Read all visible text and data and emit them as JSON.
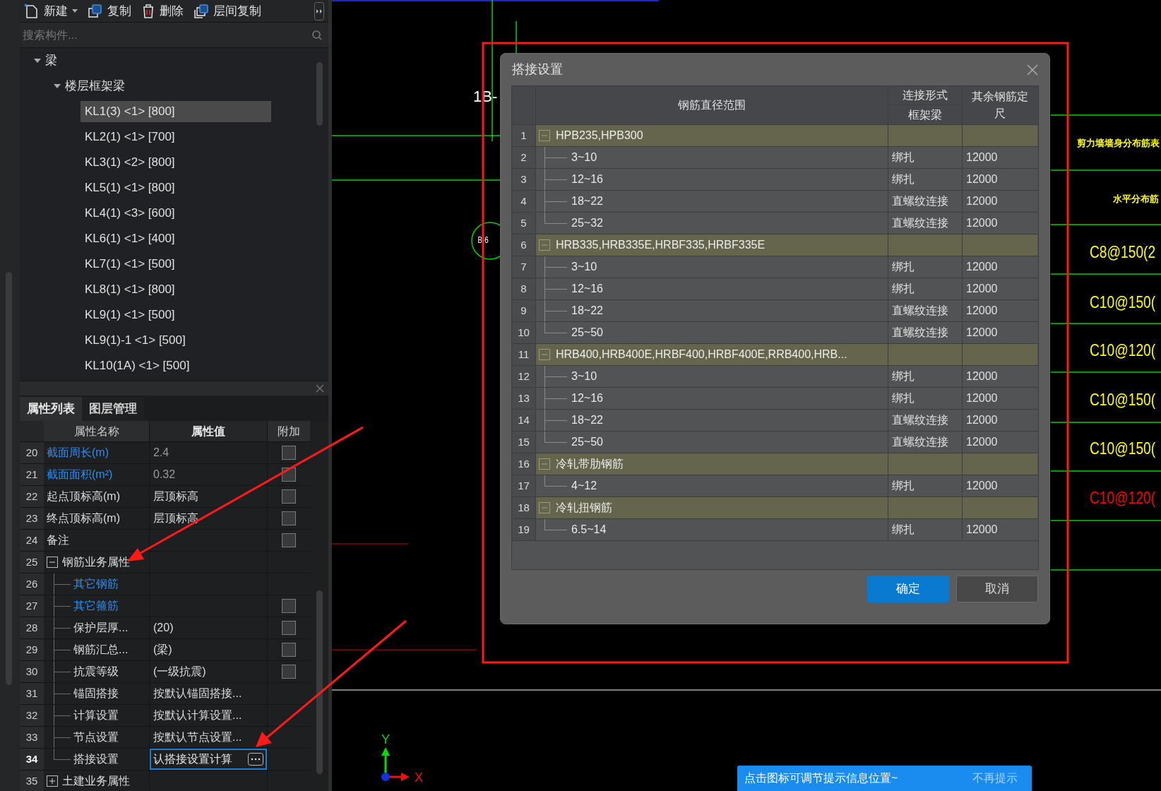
{
  "toolbar": {
    "buttons": [
      {
        "label": "新建",
        "kind": "new",
        "has_menu": true
      },
      {
        "label": "复制",
        "kind": "copy",
        "has_menu": false
      },
      {
        "label": "删除",
        "kind": "delete",
        "has_menu": false
      },
      {
        "label": "层间复制",
        "kind": "floor-copy",
        "has_menu": false
      }
    ]
  },
  "search": {
    "placeholder": "搜索构件..."
  },
  "tree": [
    {
      "label": "梁",
      "expanded": true,
      "children": [
        {
          "label": "楼层框架梁",
          "expanded": true,
          "children": [
            {
              "label": "KL1(3) <1> [800]",
              "selected": true
            },
            {
              "label": "KL2(1) <1> [700]",
              "selected": false
            },
            {
              "label": "KL3(1) <2> [800]",
              "selected": false
            },
            {
              "label": "KL5(1) <1> [800]",
              "selected": false
            },
            {
              "label": "KL4(1) <3> [600]",
              "selected": false
            },
            {
              "label": "KL6(1) <1> [400]",
              "selected": false
            },
            {
              "label": "KL7(1) <1> [500]",
              "selected": false
            },
            {
              "label": "KL8(1) <1> [800]",
              "selected": false
            },
            {
              "label": "KL9(1) <1> [500]",
              "selected": false
            },
            {
              "label": "KL9(1)-1 <1> [500]",
              "selected": false
            },
            {
              "label": "KL10(1A) <1> [500]",
              "selected": false
            }
          ]
        }
      ]
    }
  ],
  "properties": {
    "tabs": [
      {
        "label": "属性列表",
        "selected": true
      },
      {
        "label": "图层管理",
        "selected": false
      }
    ],
    "columns": [
      "属性名称",
      "属性值",
      "附加"
    ],
    "rows": [
      {
        "num": "20",
        "name": "截面周长(m)",
        "value": "2.4",
        "highlighted": true,
        "checked": false,
        "selected": false
      },
      {
        "num": "21",
        "name": "截面面积(m²)",
        "value": "0.32",
        "highlighted": true,
        "checked": false,
        "selected": false
      },
      {
        "num": "22",
        "name": "起点顶标高(m)",
        "value": "层顶标高",
        "highlighted": false,
        "checked": false,
        "selected": false
      },
      {
        "num": "23",
        "name": "终点顶标高(m)",
        "value": "层顶标高",
        "highlighted": false,
        "checked": false,
        "selected": false
      },
      {
        "num": "24",
        "name": "备注",
        "highlighted": false,
        "checked": false,
        "selected": false
      },
      {
        "num": "25",
        "name": "钢筋业务属性",
        "highlighted": false,
        "selected": false,
        "expanded": true,
        "children": [
          {
            "num": "26",
            "name": "其它钢筋",
            "highlighted": true,
            "selected": false
          },
          {
            "num": "27",
            "name": "其它箍筋",
            "highlighted": true,
            "checked": false,
            "selected": false
          },
          {
            "num": "28",
            "name": "保护层厚...",
            "value": "(20)",
            "highlighted": false,
            "checked": false,
            "selected": false
          },
          {
            "num": "29",
            "name": "钢筋汇总...",
            "value": "(梁)",
            "highlighted": false,
            "checked": false,
            "selected": false
          },
          {
            "num": "30",
            "name": "抗震等级",
            "value": "(一级抗震)",
            "highlighted": false,
            "checked": false,
            "selected": false
          },
          {
            "num": "31",
            "name": "锚固搭接",
            "value": "按默认锚固搭接...",
            "highlighted": false,
            "selected": false
          },
          {
            "num": "32",
            "name": "计算设置",
            "value": "按默认计算设置...",
            "highlighted": false,
            "selected": false
          },
          {
            "num": "33",
            "name": "节点设置",
            "value": "按默认节点设置...",
            "highlighted": false,
            "selected": false
          },
          {
            "num": "34",
            "name": "搭接设置",
            "value": "认搭接设置计算",
            "highlighted": false,
            "selected": true
          }
        ]
      },
      {
        "num": "35",
        "name": "土建业务属性",
        "highlighted": false,
        "selected": false,
        "expanded": false
      }
    ]
  },
  "canvas": {
    "grid_label": "1B-",
    "circle_label": "B-6",
    "schedule": [
      {
        "text": "剪力墙墙身分布筋表",
        "color": "#ffff00",
        "kind": "small"
      },
      {
        "text": "水平分布筋",
        "color": "#ffff00",
        "kind": "small"
      },
      {
        "text": "C8@150(2",
        "color": "#ffff00",
        "kind": "large"
      },
      {
        "text": "C10@150(",
        "color": "#ffff00",
        "kind": "large"
      },
      {
        "text": "C10@120(",
        "color": "#ffff00",
        "kind": "large"
      },
      {
        "text": "C10@150(",
        "color": "#ffff00",
        "kind": "large"
      },
      {
        "text": "C10@150(",
        "color": "#ffff00",
        "kind": "large"
      },
      {
        "text": "C10@120(",
        "color": "#ff0000",
        "kind": "large"
      }
    ],
    "axis": {
      "x": "X",
      "y": "Y"
    }
  },
  "dialog": {
    "title": "搭接设置",
    "columns": {
      "range": "钢筋直径范围",
      "joint_group": "连接形式",
      "joint": "框架梁",
      "length": "其余钢筋定尺"
    },
    "rows": [
      {
        "num": "1",
        "label": "HPB235,HPB300",
        "expanded": true,
        "children": [
          {
            "num": "2",
            "label": "3~10",
            "joint": "绑扎",
            "length": "12000"
          },
          {
            "num": "3",
            "label": "12~16",
            "joint": "绑扎",
            "length": "12000"
          },
          {
            "num": "4",
            "label": "18~22",
            "joint": "直螺纹连接",
            "length": "12000"
          },
          {
            "num": "5",
            "label": "25~32",
            "joint": "直螺纹连接",
            "length": "12000"
          }
        ]
      },
      {
        "num": "6",
        "label": "HRB335,HRB335E,HRBF335,HRBF335E",
        "expanded": true,
        "children": [
          {
            "num": "7",
            "label": "3~10",
            "joint": "绑扎",
            "length": "12000"
          },
          {
            "num": "8",
            "label": "12~16",
            "joint": "绑扎",
            "length": "12000"
          },
          {
            "num": "9",
            "label": "18~22",
            "joint": "直螺纹连接",
            "length": "12000"
          },
          {
            "num": "10",
            "label": "25~50",
            "joint": "直螺纹连接",
            "length": "12000"
          }
        ]
      },
      {
        "num": "11",
        "label": "HRB400,HRB400E,HRBF400,HRBF400E,RRB400,HRB...",
        "expanded": true,
        "children": [
          {
            "num": "12",
            "label": "3~10",
            "joint": "绑扎",
            "length": "12000"
          },
          {
            "num": "13",
            "label": "12~16",
            "joint": "绑扎",
            "length": "12000"
          },
          {
            "num": "14",
            "label": "18~22",
            "joint": "直螺纹连接",
            "length": "12000"
          },
          {
            "num": "15",
            "label": "25~50",
            "joint": "直螺纹连接",
            "length": "12000"
          }
        ]
      },
      {
        "num": "16",
        "label": "冷轧带肋钢筋",
        "expanded": true,
        "children": [
          {
            "num": "17",
            "label": "4~12",
            "joint": "绑扎",
            "length": "12000"
          }
        ]
      },
      {
        "num": "18",
        "label": "冷轧扭钢筋",
        "expanded": true,
        "children": [
          {
            "num": "19",
            "label": "6.5~14",
            "joint": "绑扎",
            "length": "12000"
          }
        ]
      }
    ],
    "buttons": [
      {
        "label": "确定",
        "kind": "primary"
      },
      {
        "label": "取消",
        "kind": "secondary"
      }
    ]
  },
  "hint_bar": {
    "message": "点击图标可调节提示信息位置~",
    "dismiss": "不再提示"
  }
}
